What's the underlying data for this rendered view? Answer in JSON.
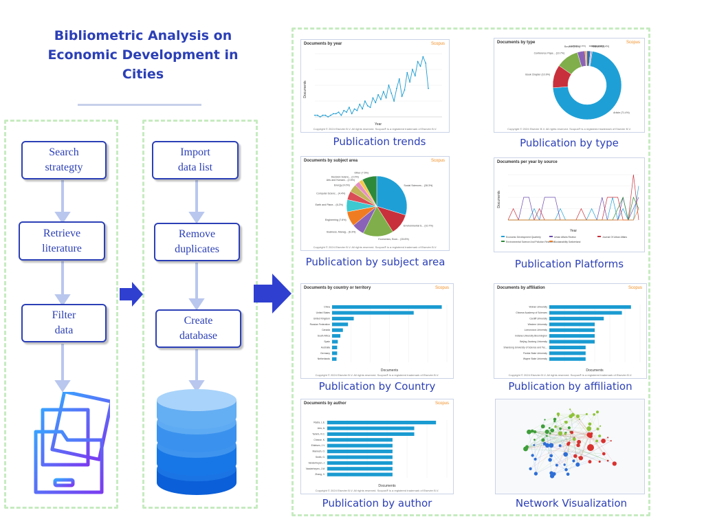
{
  "title": "Bibliometric Analysis on\nEconomic Development in\nCities",
  "steps": {
    "search": "Search\nstrategty",
    "retrieve": "Retrieve\nliterature",
    "filter": "Filter\ndata",
    "import": "Import\ndata list",
    "remove": "Remove\nduplicates",
    "create": "Create\ndatabase"
  },
  "colors": {
    "primary": "#2b3fb6",
    "panel_border": "#c6ebc0",
    "arrow": "#2f3fd0",
    "chart_bar": "#1a9bd1",
    "scopus": "#f08a1c"
  },
  "icons": {
    "folder": "folder-documents-icon",
    "database": "database-icon",
    "arrow": "right-arrow-icon"
  },
  "captions": {
    "trends": "Publication trends",
    "type": "Publication by type",
    "subject": "Publication by subject area",
    "platforms": "Publication Platforms",
    "country": "Publication by Country",
    "affiliation": "Publication by affiliation",
    "author": "Publication by author",
    "network": "Network Visualization"
  },
  "thumbs": {
    "trends_title": "Documents by year",
    "type_title": "Documents by type",
    "subject_title": "Documents by subject area",
    "platforms_title": "Documents per year by source",
    "country_title": "Documents by country or territory",
    "affiliation_title": "Documents by affiliation",
    "author_title": "Documents by author",
    "scopus": "Scopus",
    "copyright": "Copyright © 2024 Elsevier B.V. All rights reserved. Scopus® is a registered trademark of Elsevier B.V."
  },
  "chart_data": [
    {
      "type": "line",
      "title": "Documents by year",
      "ylabel": "Documents",
      "xlabel": "Year",
      "y": [
        1,
        1,
        0,
        1,
        1,
        0,
        1,
        2,
        2,
        3,
        1,
        4,
        3,
        6,
        2,
        5,
        4,
        8,
        5,
        10,
        7,
        6,
        12,
        9,
        14,
        11,
        16,
        12,
        20,
        15,
        10,
        18,
        24,
        13,
        17,
        28,
        22,
        30,
        26,
        35,
        32,
        38,
        34,
        18
      ]
    },
    {
      "type": "pie",
      "title": "Documents by type",
      "slices": [
        {
          "label": "Article (71.4%)",
          "value": 71.4
        },
        {
          "label": "Book Chapter (10.9%)",
          "value": 10.9
        },
        {
          "label": "Conference Pape... (10.7%)",
          "value": 10.7
        },
        {
          "label": "Review (3.6%)",
          "value": 3.6
        },
        {
          "label": "Erratum (0.9%)",
          "value": 0.9
        },
        {
          "label": "Book (1.7%)",
          "value": 1.7
        },
        {
          "label": "Note (0.4%)",
          "value": 0.4
        },
        {
          "label": "Editorial (0.4%)",
          "value": 0.4
        }
      ]
    },
    {
      "type": "pie",
      "title": "Documents by subject area",
      "slices": [
        {
          "label": "Social Sciences... (28.3%)",
          "value": 28.3
        },
        {
          "label": "Environmental S... (10.7%)",
          "value": 10.7
        },
        {
          "label": "Economics, Econ... (15.6%)",
          "value": 15.6
        },
        {
          "label": "Business, Manag... (6.3%)",
          "value": 6.3
        },
        {
          "label": "Engineering (7.6%)",
          "value": 7.6
        },
        {
          "label": "Earth and Plane... (6.2%)",
          "value": 6.2
        },
        {
          "label": "Computer Scienc... (4.4%)",
          "value": 4.4
        },
        {
          "label": "Energy (4.0%)",
          "value": 4.0
        },
        {
          "label": "Arts and Humani... (2.5%)",
          "value": 2.5
        },
        {
          "label": "Decision Scienc... (2.0%)",
          "value": 2.0
        },
        {
          "label": "Other (7.5%)",
          "value": 7.5
        }
      ]
    },
    {
      "type": "line",
      "title": "Documents per year by source",
      "ylabel": "Documents",
      "xlabel": "Year",
      "series": [
        {
          "name": "Economic Development Quarterly",
          "values": [
            0,
            0,
            0,
            0,
            0,
            1,
            0,
            0,
            0,
            0,
            1,
            0,
            0,
            0,
            0,
            0,
            1,
            0,
            0,
            0,
            2,
            0,
            1,
            0,
            0,
            3
          ]
        },
        {
          "name": "Urban Affairs Review",
          "values": [
            0,
            0,
            0,
            2,
            2,
            0,
            0,
            2,
            2,
            2,
            0,
            0,
            0,
            0,
            0,
            0,
            0,
            0,
            2,
            0,
            0,
            0,
            2,
            0,
            1,
            2
          ]
        },
        {
          "name": "Journal Of Urban Affairs",
          "values": [
            0,
            1,
            0,
            0,
            0,
            0,
            1,
            0,
            0,
            0,
            0,
            0,
            0,
            0,
            1,
            0,
            0,
            0,
            0,
            2,
            2,
            2,
            0,
            0,
            4,
            0
          ]
        },
        {
          "name": "Environmental Science And Pollution Research",
          "values": [
            0,
            0,
            0,
            0,
            0,
            0,
            0,
            0,
            0,
            0,
            0,
            0,
            0,
            0,
            0,
            0,
            0,
            0,
            0,
            0,
            0,
            1,
            2,
            0,
            2,
            1
          ]
        },
        {
          "name": "Sustainability Switzerland",
          "values": [
            0,
            0,
            0,
            0,
            0,
            0,
            0,
            0,
            0,
            0,
            0,
            0,
            0,
            0,
            0,
            0,
            0,
            0,
            0,
            0,
            0,
            0,
            0,
            0,
            0,
            1
          ]
        }
      ]
    },
    {
      "type": "bar",
      "title": "Documents by country or territory",
      "xlabel": "Documents",
      "categories": [
        "China",
        "United States",
        "United Kingdom",
        "Russian Federation",
        "Canada",
        "South Africa",
        "Spain",
        "Australia",
        "Germany",
        "Netherlands"
      ],
      "values": [
        172,
        128,
        34,
        25,
        17,
        13,
        9,
        8,
        8,
        7
      ],
      "xlim": [
        0,
        180
      ]
    },
    {
      "type": "bar",
      "title": "Documents by affiliation",
      "xlabel": "Documents",
      "categories": [
        "Wuhan University",
        "Chinese Academy of Sciences",
        "Cardiff University",
        "Western University",
        "Lomonosov University",
        "Indiana University Bloomington",
        "Beijing Jiaotong University",
        "Shandong University of Science and Tec...",
        "Florida State University",
        "Wayne State University"
      ],
      "values": [
        9,
        8,
        6,
        5,
        5,
        5,
        5,
        4,
        4,
        4
      ],
      "xlim": [
        0,
        10
      ]
    },
    {
      "type": "bar",
      "title": "Documents by author",
      "xlabel": "Documents",
      "categories": [
        "Rasta, L.E.",
        "Arro, A.",
        "Tamrin, R.C.",
        "Chesve, K.",
        "Ehlelsen, J.V.",
        "Mamesh, O.",
        "Smith, G.",
        "Vanderheyen, J.",
        "Vanderheyen, J.M.",
        "Zhang, X."
      ],
      "values": [
        5,
        4,
        4,
        3,
        3,
        3,
        3,
        3,
        3,
        3
      ],
      "xlim": [
        0,
        5.5
      ]
    }
  ]
}
